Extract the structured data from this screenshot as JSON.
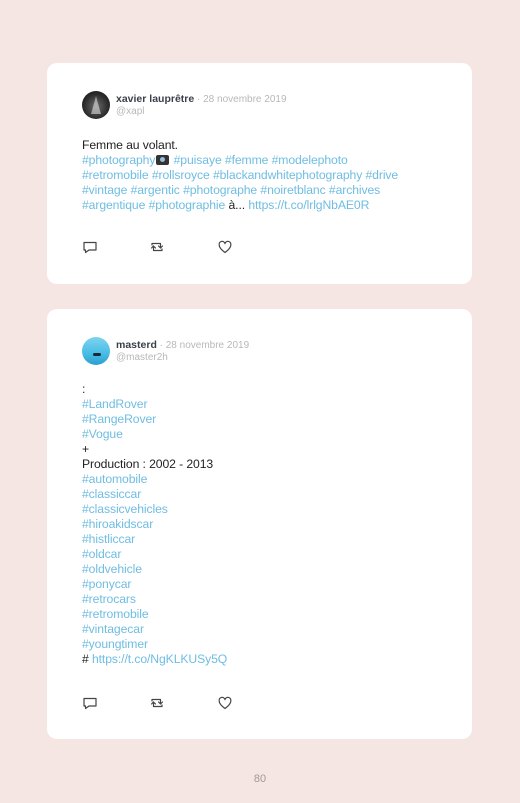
{
  "posts": [
    {
      "author": "xavier lauprêtre",
      "date_sep": " · ",
      "date": "28 novembre 2019",
      "handle": "@xapl",
      "line1": "Femme au volant.",
      "tags_a": "#photography",
      "tags_b": " #puisaye #femme #modelephoto",
      "tags_c": "#retromobile #rollsroyce #blackandwhitephotography #drive",
      "tags_d": "#vintage #argentic #photographe #noiretblanc #archives",
      "tags_e": "#argentique #photographie",
      "tail": " à... ",
      "link": "https://t.co/lrlgNbAE0R"
    },
    {
      "author": "masterd",
      "date_sep": " · ",
      "date": "28 novembre 2019",
      "handle": "@master2h",
      "lines": [
        {
          "text": ":",
          "type": "text"
        },
        {
          "text": "#LandRover",
          "type": "tag"
        },
        {
          "text": "#RangeRover",
          "type": "tag"
        },
        {
          "text": "#Vogue",
          "type": "tag"
        },
        {
          "text": "+",
          "type": "text"
        },
        {
          "text": "Production : 2002 - 2013",
          "type": "text"
        },
        {
          "text": "#automobile",
          "type": "tag"
        },
        {
          "text": "#classiccar",
          "type": "tag"
        },
        {
          "text": "#classicvehicles",
          "type": "tag"
        },
        {
          "text": "#hiroakidscar",
          "type": "tag"
        },
        {
          "text": "#histliccar",
          "type": "tag"
        },
        {
          "text": "#oldcar",
          "type": "tag"
        },
        {
          "text": "#oldvehicle",
          "type": "tag"
        },
        {
          "text": "#ponycar",
          "type": "tag"
        },
        {
          "text": "#retrocars",
          "type": "tag"
        },
        {
          "text": "#retromobile",
          "type": "tag"
        },
        {
          "text": "#vintagecar",
          "type": "tag"
        },
        {
          "text": "#youngtimer",
          "type": "tag"
        }
      ],
      "last_prefix": "# ",
      "link": "https://t.co/NgKLKUSy5Q"
    }
  ],
  "page_number": "80",
  "colors": {
    "background": "#f5e6e3",
    "card": "#ffffff",
    "hashtag": "#6fbde2",
    "muted": "#b8b8b8"
  },
  "icons": [
    "reply-icon",
    "retweet-icon",
    "like-icon",
    "camera-emoji-icon"
  ]
}
